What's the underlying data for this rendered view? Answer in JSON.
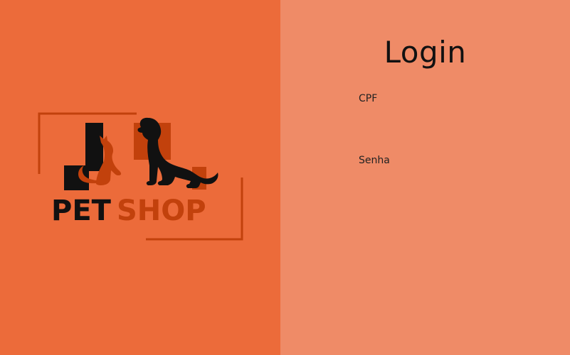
{
  "logo": {
    "word1": "PET",
    "word2": "SHOP"
  },
  "login": {
    "title": "Login",
    "cpf_label": "CPF",
    "cpf_value": "",
    "senha_label": "Senha",
    "senha_value": ""
  },
  "colors": {
    "left_background": "#ec6b3a",
    "right_background": "#ef8b67",
    "logo_accent": "#c2410c",
    "text": "#111111"
  },
  "icons": {
    "logo_pets": "cat-and-dog-silhouette-icon"
  }
}
